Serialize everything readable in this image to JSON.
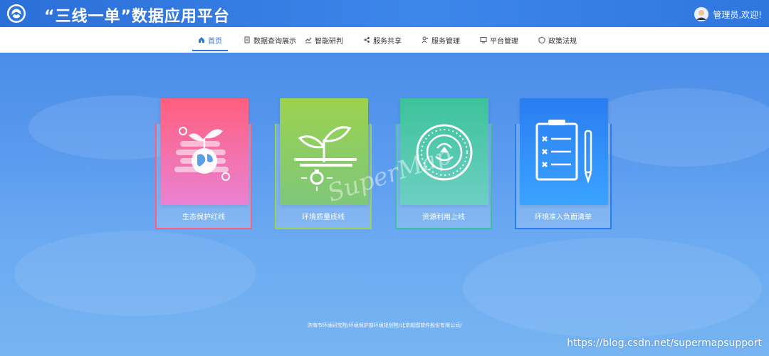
{
  "header": {
    "title": "“三线一单”数据应用平台",
    "user_greeting": "管理员,欢迎!"
  },
  "nav": {
    "items": [
      {
        "label": "首页",
        "icon": "home-icon",
        "active": true
      },
      {
        "label": "数据查询展示",
        "icon": "document-icon",
        "active": false
      },
      {
        "label": "智能研判",
        "icon": "analysis-icon",
        "active": false
      },
      {
        "label": "服务共享",
        "icon": "share-icon",
        "active": false
      },
      {
        "label": "服务管理",
        "icon": "manage-icon",
        "active": false
      },
      {
        "label": "平台管理",
        "icon": "platform-icon",
        "active": false
      },
      {
        "label": "政策法规",
        "icon": "policy-icon",
        "active": false
      }
    ]
  },
  "cards": [
    {
      "label": "生态保护红线",
      "color_top": "#ff5f7e",
      "color_bottom": "#e982d3",
      "frame_color": "#ff5f7e",
      "icon": "earth-plant-icon"
    },
    {
      "label": "环境质量底线",
      "color_top": "#9bd24e",
      "color_bottom": "#7fc77b",
      "frame_color": "#9bd24e",
      "icon": "sprout-light-icon"
    },
    {
      "label": "资源利用上线",
      "color_top": "#3cc29b",
      "color_bottom": "#6dd0c4",
      "frame_color": "#3cc29b",
      "icon": "resource-coin-icon"
    },
    {
      "label": "环境准入负面清单",
      "color_top": "#2a7df0",
      "color_bottom": "#3aa3ff",
      "frame_color": "#2a7df0",
      "icon": "checklist-icon"
    }
  ],
  "watermark": "SuperMap",
  "footer": {
    "credits": "济南市环境研究院/环境保护部环境规划院/北京超图软件股份有限公司/"
  },
  "page_url": "https://blog.csdn.net/supermapsupport"
}
